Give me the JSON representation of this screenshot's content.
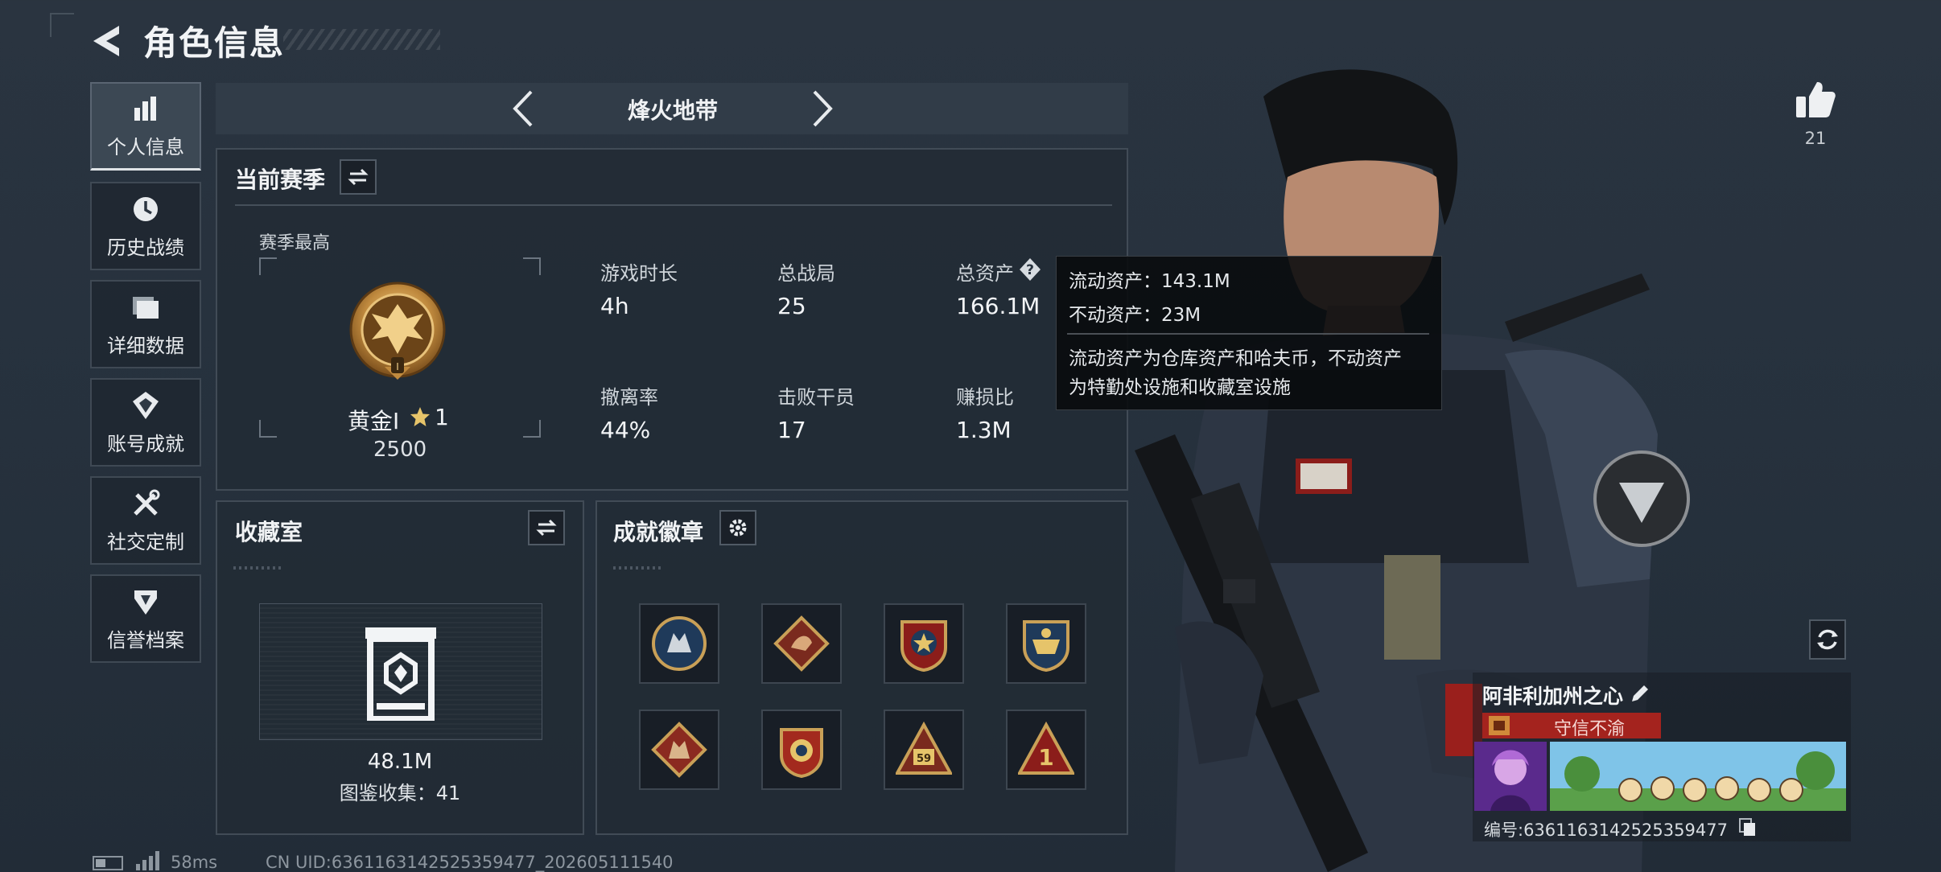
{
  "header": {
    "title": "角色信息"
  },
  "sidebar": {
    "items": [
      {
        "label": "个人信息",
        "icon": "bar-chart-icon",
        "active": true
      },
      {
        "label": "历史战绩",
        "icon": "clock-icon",
        "active": false
      },
      {
        "label": "详细数据",
        "icon": "folder-icon",
        "active": false
      },
      {
        "label": "账号成就",
        "icon": "achievement-icon",
        "active": false
      },
      {
        "label": "社交定制",
        "icon": "tools-icon",
        "active": false
      },
      {
        "label": "信誉档案",
        "icon": "shield-icon",
        "active": false
      }
    ]
  },
  "game_tab": {
    "title": "烽火地带"
  },
  "season": {
    "title": "当前赛季",
    "best_label": "赛季最高",
    "rank_name": "黄金Ⅰ",
    "rank_stars": "1",
    "rank_points": "2500",
    "stats": [
      {
        "label": "游戏时长",
        "value": "4h"
      },
      {
        "label": "总战局",
        "value": "25"
      },
      {
        "label": "总资产",
        "value": "166.1M"
      },
      {
        "label": "撤离率",
        "value": "44%"
      },
      {
        "label": "击败干员",
        "value": "17"
      },
      {
        "label": "赚损比",
        "value": "1.3M"
      }
    ]
  },
  "tooltip": {
    "liquid": "流动资产：143.1M",
    "fixed": "不动资产：23M",
    "desc_line1": "流动资产为仓库资产和哈夫币，不动资产",
    "desc_line2": "为特勤处设施和收藏室设施"
  },
  "collection": {
    "title": "收藏室",
    "value": "48.1M",
    "catalog": "图鉴收集：41"
  },
  "badges": {
    "title": "成就徽章",
    "items": [
      "wolf-badge",
      "dragon-badge",
      "star-badge",
      "skull-badge",
      "wolf-diamond-badge",
      "shield-badge",
      "triangle-59-badge",
      "triangle-1-badge"
    ]
  },
  "likes": {
    "count": "21"
  },
  "card": {
    "name": "阿非利加州之心",
    "reputation": "守信不渝",
    "uid": "编号:6361163142525359477"
  },
  "status": {
    "ping": "58ms",
    "uid_footer": "CN UID:6361163142525359477_202605111540"
  },
  "colors": {
    "background": "#26313d",
    "panel": "#222b35",
    "reputation_red": "#a4231e",
    "accent_gold": "#c9a057"
  }
}
